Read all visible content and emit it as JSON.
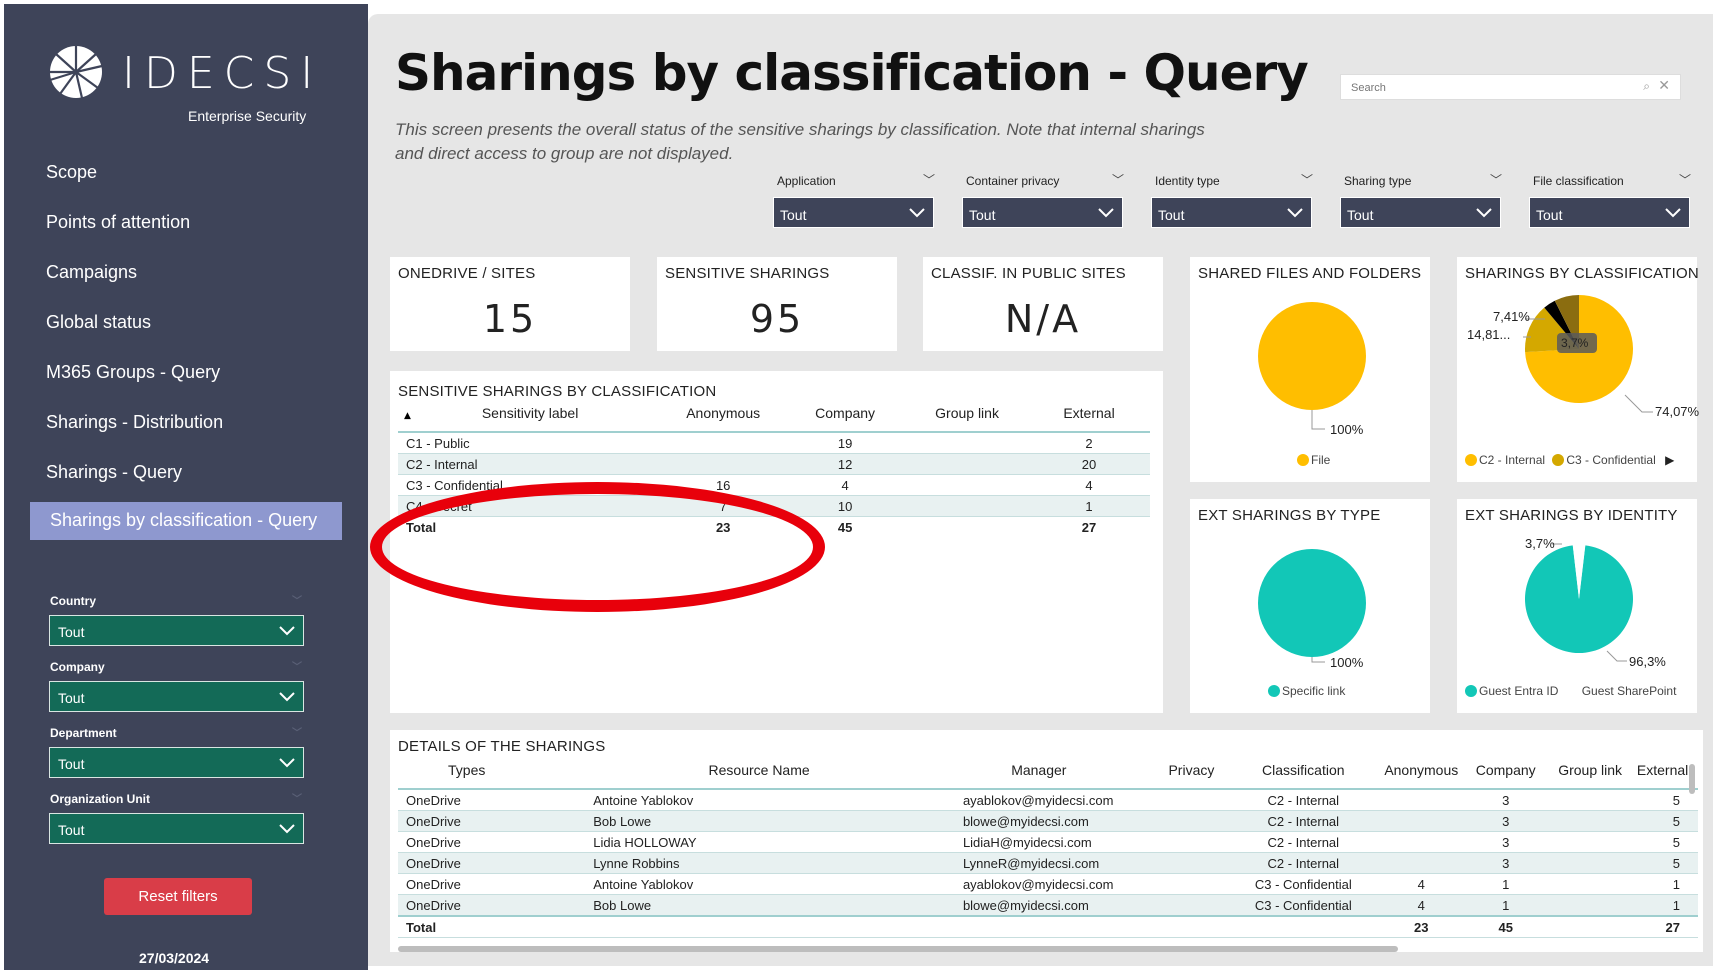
{
  "brand": {
    "name": "IDECSI",
    "tagline": "Enterprise Security"
  },
  "nav": [
    "Scope",
    "Points of attention",
    "Campaigns",
    "Global status",
    "M365 Groups - Query",
    "Sharings - Distribution",
    "Sharings - Query",
    "Sharings by classification - Query"
  ],
  "sidebar_filters": [
    {
      "label": "Country",
      "value": "Tout"
    },
    {
      "label": "Company",
      "value": "Tout"
    },
    {
      "label": "Department",
      "value": "Tout"
    },
    {
      "label": "Organization Unit",
      "value": "Tout"
    }
  ],
  "reset_label": "Reset filters",
  "date": "27/03/2024",
  "page": {
    "title": "Sharings by classification - Query",
    "description": "This screen presents the overall status of the sensitive sharings by classification. Note that internal sharings and direct access to group are not displayed."
  },
  "search": {
    "placeholder": "Search"
  },
  "filters": [
    {
      "label": "Application",
      "value": "Tout"
    },
    {
      "label": "Container privacy",
      "value": "Tout"
    },
    {
      "label": "Identity type",
      "value": "Tout"
    },
    {
      "label": "Sharing type",
      "value": "Tout"
    },
    {
      "label": "File classification",
      "value": "Tout"
    }
  ],
  "kpis": [
    {
      "label": "ONEDRIVE / SITES",
      "value": "15"
    },
    {
      "label": "SENSITIVE SHARINGS",
      "value": "95"
    },
    {
      "label": "CLASSIF. IN PUBLIC SITES",
      "value": "N/A"
    }
  ],
  "classification_table": {
    "title": "SENSITIVE SHARINGS BY CLASSIFICATION",
    "columns": [
      "Sensitivity label",
      "Anonymous",
      "Company",
      "Group link",
      "External"
    ],
    "rows": [
      [
        "C1 - Public",
        "",
        "19",
        "",
        "2"
      ],
      [
        "C2 - Internal",
        "",
        "12",
        "",
        "20"
      ],
      [
        "C3 - Confidential",
        "16",
        "4",
        "",
        "4"
      ],
      [
        "C4 - Secret",
        "7",
        "10",
        "",
        "1"
      ]
    ],
    "total": [
      "Total",
      "23",
      "45",
      "",
      "27"
    ]
  },
  "charts": {
    "shared_files": {
      "title": "SHARED FILES AND FOLDERS",
      "label": "100%",
      "legend": [
        "File"
      ],
      "color": "#ffbe00"
    },
    "sharings_by_classification": {
      "title": "SHARINGS BY CLASSIFICATION",
      "labels": {
        "a": "7,41%",
        "b": "14,81...",
        "c": "3,7%",
        "d": "74,07%"
      },
      "legend": [
        "C2 - Internal",
        "C3 - Confidential"
      ],
      "colors": {
        "c2": "#ffbe00",
        "c3": "#d4a800",
        "c4": "#000000",
        "c1": "#8b6d10"
      }
    },
    "ext_by_type": {
      "title": "EXT SHARINGS BY TYPE",
      "label": "100%",
      "legend": [
        "Specific link"
      ],
      "color": "#12c7b7"
    },
    "ext_by_identity": {
      "title": "EXT SHARINGS BY IDENTITY",
      "labels": {
        "a": "3,7%",
        "b": "96,3%"
      },
      "legend": [
        "Guest Entra ID",
        "Guest SharePoint"
      ],
      "color": "#12c7b7"
    }
  },
  "chart_data": [
    {
      "type": "pie",
      "title": "SHARED FILES AND FOLDERS",
      "categories": [
        "File"
      ],
      "values": [
        100
      ]
    },
    {
      "type": "pie",
      "title": "SHARINGS BY CLASSIFICATION",
      "categories": [
        "C2 - Internal",
        "C3 - Confidential",
        "C4 - Secret",
        "C1 - Public"
      ],
      "values": [
        74.07,
        14.81,
        3.7,
        7.41
      ]
    },
    {
      "type": "pie",
      "title": "EXT SHARINGS BY TYPE",
      "categories": [
        "Specific link"
      ],
      "values": [
        100
      ]
    },
    {
      "type": "pie",
      "title": "EXT SHARINGS BY IDENTITY",
      "categories": [
        "Guest Entra ID",
        "Guest SharePoint"
      ],
      "values": [
        96.3,
        3.7
      ]
    }
  ],
  "details": {
    "title": "DETAILS OF THE SHARINGS",
    "columns": [
      "Types",
      "Resource Name",
      "Manager",
      "Privacy",
      "Classification",
      "Anonymous",
      "Company",
      "Group link",
      "External"
    ],
    "rows": [
      [
        "OneDrive",
        "Antoine Yablokov",
        "ayablokov@myidecsi.com",
        "",
        "C2 - Internal",
        "",
        "3",
        "",
        "5"
      ],
      [
        "OneDrive",
        "Bob Lowe",
        "blowe@myidecsi.com",
        "",
        "C2 - Internal",
        "",
        "3",
        "",
        "5"
      ],
      [
        "OneDrive",
        "Lidia HOLLOWAY",
        "LidiaH@myidecsi.com",
        "",
        "C2 - Internal",
        "",
        "3",
        "",
        "5"
      ],
      [
        "OneDrive",
        "Lynne Robbins",
        "LynneR@myidecsi.com",
        "",
        "C2 - Internal",
        "",
        "3",
        "",
        "5"
      ],
      [
        "OneDrive",
        "Antoine Yablokov",
        "ayablokov@myidecsi.com",
        "",
        "C3 - Confidential",
        "4",
        "1",
        "",
        "1"
      ],
      [
        "OneDrive",
        "Bob Lowe",
        "blowe@myidecsi.com",
        "",
        "C3 - Confidential",
        "4",
        "1",
        "",
        "1"
      ]
    ],
    "total": [
      "Total",
      "",
      "",
      "",
      "",
      "23",
      "45",
      "",
      "27"
    ]
  }
}
